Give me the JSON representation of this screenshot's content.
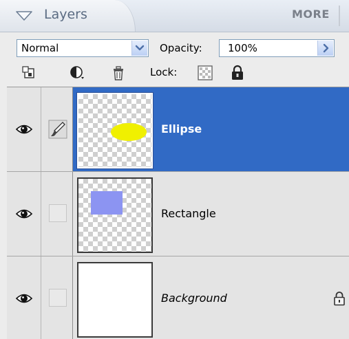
{
  "panel": {
    "title": "Layers",
    "more_label": "MORE"
  },
  "blend": {
    "mode": "Normal",
    "opacity_label": "Opacity:",
    "opacity_value": "100%"
  },
  "toolbar": {
    "lock_label": "Lock:",
    "icons": [
      "new-layer-icon",
      "adjustment-layer-icon",
      "trash-icon",
      "lock-transparency-icon",
      "lock-all-icon"
    ]
  },
  "layers": [
    {
      "name": "Ellipse",
      "selected": true,
      "visible": true,
      "content": "yellow-ellipse"
    },
    {
      "name": "Rectangle",
      "selected": false,
      "visible": true,
      "content": "blue-rectangle"
    },
    {
      "name": "Background",
      "selected": false,
      "visible": true,
      "content": "white-fill",
      "locked": true
    }
  ],
  "colors": {
    "selection": "#316ac5",
    "ellipse_fill": "#f0f000",
    "rectangle_fill": "#8c94f2"
  }
}
